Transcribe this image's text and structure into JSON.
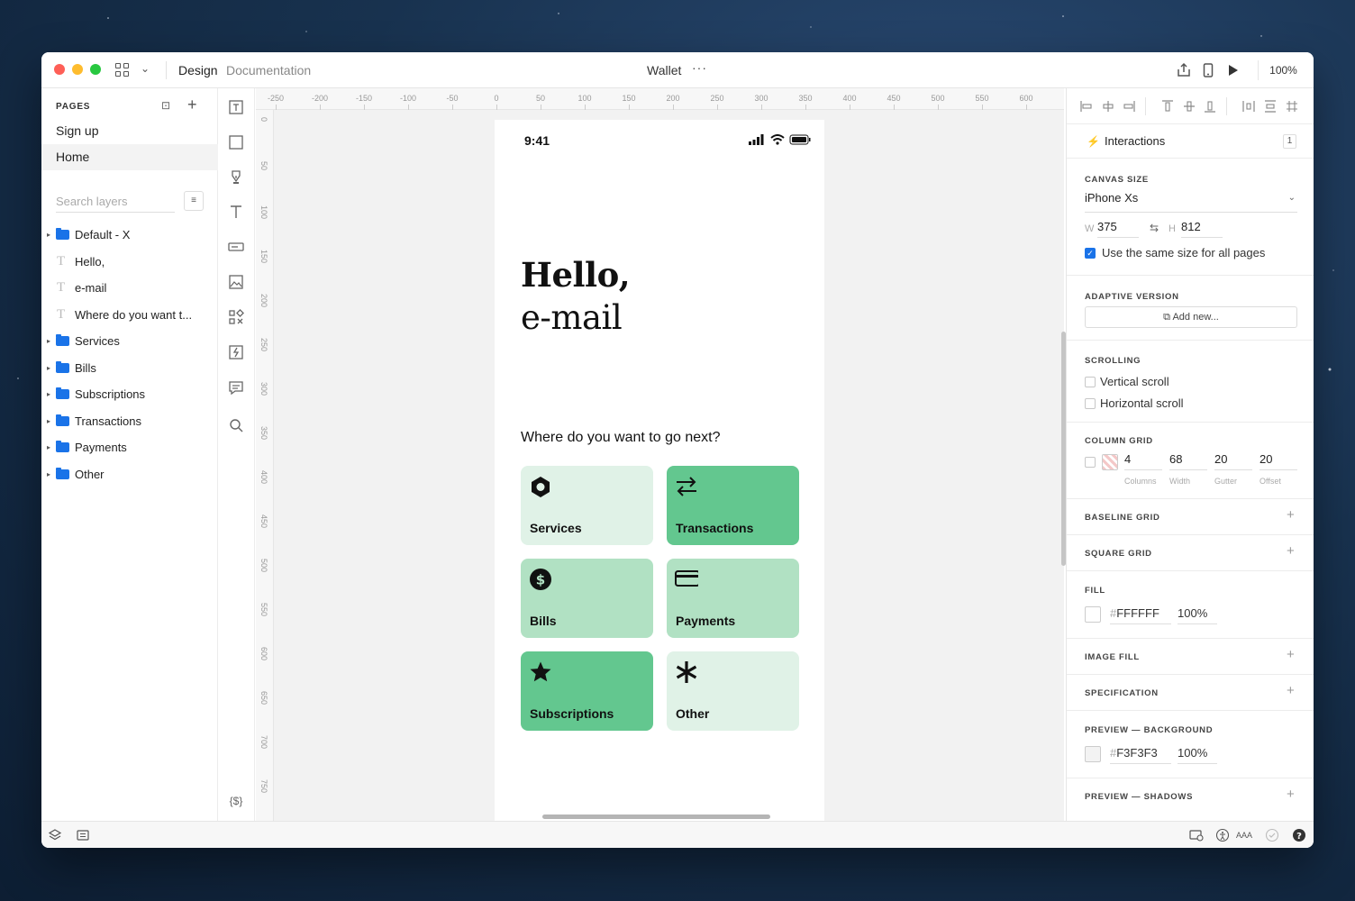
{
  "titlebar": {
    "tab_design": "Design",
    "tab_documentation": "Documentation",
    "document_title": "Wallet",
    "more_label": "···",
    "zoom": "100%"
  },
  "pages": {
    "label": "PAGES",
    "items": [
      {
        "label": "Sign up",
        "active": false
      },
      {
        "label": "Home",
        "active": true
      }
    ]
  },
  "layers": {
    "search_placeholder": "Search layers",
    "items": [
      {
        "type": "folder",
        "name": "Default - X"
      },
      {
        "type": "text",
        "name": "Hello,"
      },
      {
        "type": "text",
        "name": "e-mail"
      },
      {
        "type": "text",
        "name": "Where do you want t..."
      },
      {
        "type": "folder",
        "name": "Services"
      },
      {
        "type": "folder",
        "name": "Bills"
      },
      {
        "type": "folder",
        "name": "Subscriptions"
      },
      {
        "type": "folder",
        "name": "Transactions"
      },
      {
        "type": "folder",
        "name": "Payments"
      },
      {
        "type": "folder",
        "name": "Other"
      }
    ]
  },
  "tools": {
    "variables_label": "{$}"
  },
  "rulers": {
    "top": [
      "-250",
      "-200",
      "-150",
      "-100",
      "-50",
      "0",
      "50",
      "100",
      "150",
      "200",
      "250",
      "300",
      "350",
      "400",
      "450",
      "500",
      "550",
      "600"
    ],
    "left": [
      "0",
      "50",
      "100",
      "150",
      "200",
      "250",
      "300",
      "350",
      "400",
      "450",
      "500",
      "550",
      "600",
      "650",
      "700",
      "750"
    ]
  },
  "artboard": {
    "time": "9:41",
    "greeting_line1": "Hello,",
    "greeting_line2": "e-mail",
    "question": "Where do you want to go next?",
    "cards": [
      {
        "label": "Services",
        "icon": "hexagon-icon",
        "color": "#e0f2e7"
      },
      {
        "label": "Transactions",
        "icon": "swap-arrows-icon",
        "color": "#63c78f"
      },
      {
        "label": "Bills",
        "icon": "dollar-coin-icon",
        "color": "#b1e1c3"
      },
      {
        "label": "Payments",
        "icon": "credit-card-icon",
        "color": "#b1e1c3"
      },
      {
        "label": "Subscriptions",
        "icon": "star-icon",
        "color": "#63c78f"
      },
      {
        "label": "Other",
        "icon": "asterisk-icon",
        "color": "#e0f2e7"
      }
    ]
  },
  "inspector": {
    "interactions_label": "Interactions",
    "interactions_count": "1",
    "canvas_size_title": "CANVAS SIZE",
    "canvas_size_value": "iPhone Xs",
    "width_label": "W",
    "width_value": "375",
    "height_label": "H",
    "height_value": "812",
    "same_size_label": "Use the same size for all pages",
    "same_size_checked": true,
    "adaptive_title": "ADAPTIVE VERSION",
    "add_new_label": "Add new...",
    "scrolling_title": "SCROLLING",
    "vertical_scroll_label": "Vertical scroll",
    "horizontal_scroll_label": "Horizontal scroll",
    "column_grid_title": "COLUMN GRID",
    "column_grid": {
      "columns": "4",
      "columns_caption": "Columns",
      "width": "68",
      "width_caption": "Width",
      "gutter": "20",
      "gutter_caption": "Gutter",
      "offset": "20",
      "offset_caption": "Offset"
    },
    "baseline_grid_title": "BASELINE GRID",
    "square_grid_title": "SQUARE GRID",
    "fill_title": "FILL",
    "fill_hex": "FFFFFF",
    "fill_opacity": "100%",
    "image_fill_title": "IMAGE FILL",
    "specification_title": "SPECIFICATION",
    "preview_bg_title": "PREVIEW — BACKGROUND",
    "preview_bg_hex": "F3F3F3",
    "preview_bg_opacity": "100%",
    "preview_shadows_title": "PREVIEW — SHADOWS"
  },
  "bottombar": {
    "contrast_label": "AAA"
  }
}
